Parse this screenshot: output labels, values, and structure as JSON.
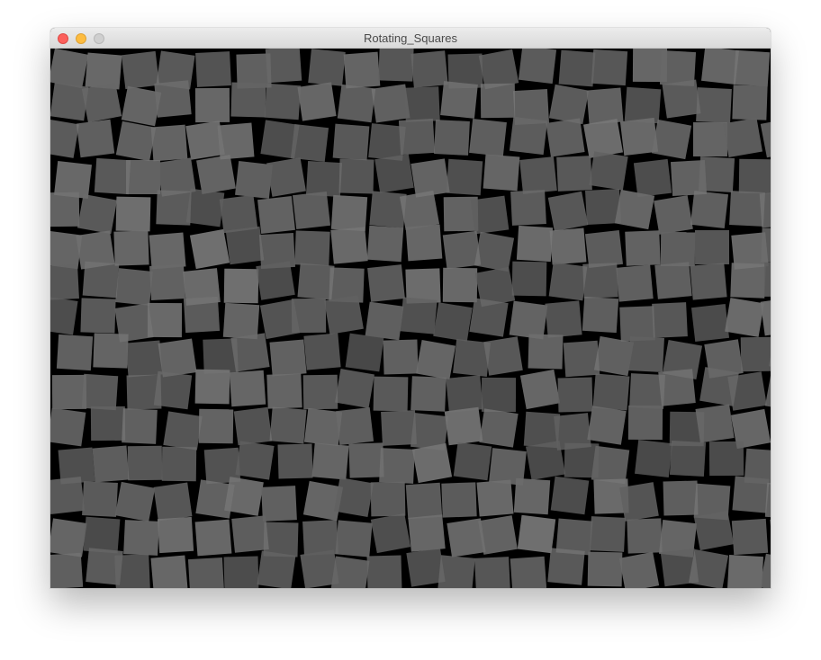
{
  "window": {
    "title": "Rotating_Squares"
  },
  "colors": {
    "canvas_background": "#000000",
    "square_fill": "#6e6e6e",
    "close_button": "#fc605c",
    "minimize_button": "#fdbc40",
    "zoom_button": "#cfcfcf"
  },
  "icons": [
    "close-button-icon",
    "minimize-button-icon",
    "zoom-button-icon"
  ]
}
